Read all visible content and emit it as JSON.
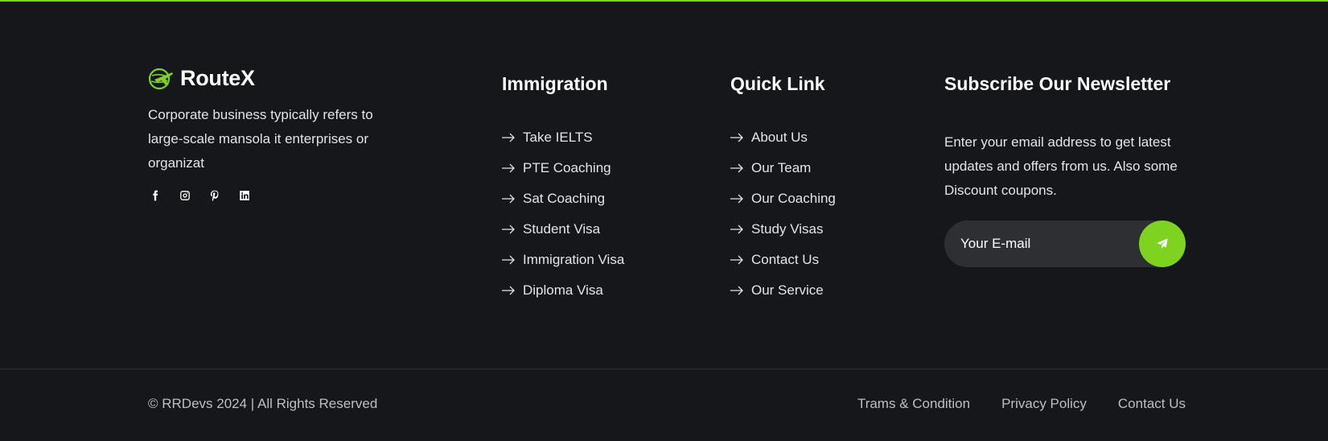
{
  "brand": {
    "name": "RouteX",
    "description": "Corporate business typically refers to large-scale mansola it enterprises or organizat",
    "accent_color": "#7ed321",
    "socials": [
      {
        "icon": "facebook-icon"
      },
      {
        "icon": "instagram-icon"
      },
      {
        "icon": "pinterest-icon"
      },
      {
        "icon": "linkedin-icon"
      }
    ]
  },
  "immigration": {
    "title": "Immigration",
    "links": [
      "Take IELTS",
      "PTE Coaching",
      "Sat Coaching",
      "Student Visa",
      "Immigration Visa",
      "Diploma Visa"
    ]
  },
  "quick_link": {
    "title": "Quick Link",
    "links": [
      "About Us",
      "Our Team",
      "Our Coaching",
      "Study Visas",
      "Contact Us",
      "Our Service"
    ]
  },
  "newsletter": {
    "title": "Subscribe Our Newsletter",
    "description": "Enter your email address to get latest updates and offers from us. Also some Discount coupons.",
    "placeholder": "Your E-mail",
    "submit_icon": "send-icon"
  },
  "bottom": {
    "copyright": "© RRDevs 2024 | All Rights Reserved",
    "links": [
      "Trams & Condition",
      "Privacy Policy",
      "Contact Us"
    ]
  }
}
